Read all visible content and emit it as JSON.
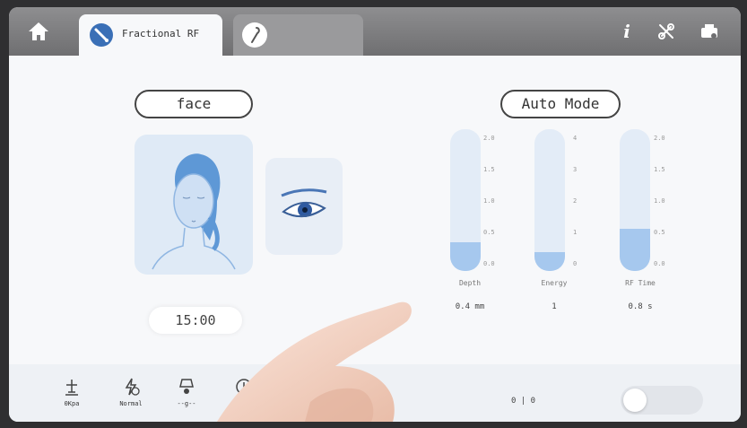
{
  "header": {
    "active_tab_label": "Fractional RF",
    "icons": [
      "home-icon",
      "handpiece-icon",
      "handpiece-2-icon",
      "info-icon",
      "disconnect-icon",
      "printer-icon"
    ],
    "info_glyph": "i"
  },
  "left": {
    "area_label": "face",
    "timer": "15:00"
  },
  "right": {
    "mode_label": "Auto Mode",
    "sliders": [
      {
        "label": "Depth",
        "value": "0.4 mm",
        "ticks": [
          "2.0",
          "1.5",
          "1.0",
          "0.5",
          "0.0"
        ],
        "level": 0.2
      },
      {
        "label": "Energy",
        "value": "1",
        "ticks": [
          "4",
          "3",
          "2",
          "1",
          "0"
        ],
        "level": 0.13
      },
      {
        "label": "RF Time",
        "value": "0.8 s",
        "ticks": [
          "2.0",
          "1.5",
          "1.0",
          "0.5",
          "0.0"
        ],
        "level": 0.3
      }
    ]
  },
  "footer": {
    "items": [
      {
        "icon": "pressure-icon",
        "label": "0Kpa"
      },
      {
        "icon": "lightning-icon",
        "label": "Normal"
      },
      {
        "icon": "handpiece-tip-icon",
        "label": "--g--"
      },
      {
        "icon": "clock-icon",
        "label": ""
      }
    ],
    "counter": "0 | 0"
  },
  "colors": {
    "accent": "#a6c8ee",
    "topbar": "#7d7d7f",
    "background": "#f7f8fa"
  }
}
